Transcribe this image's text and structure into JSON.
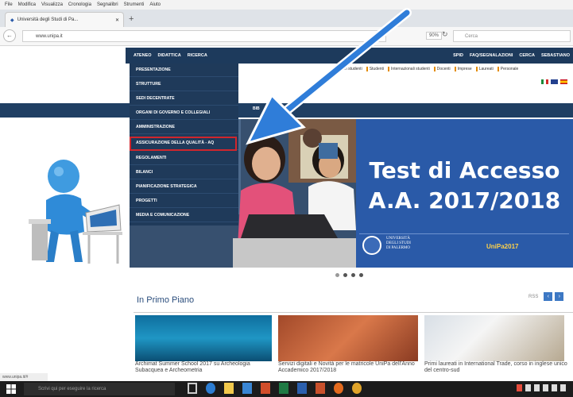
{
  "browser": {
    "menu": [
      "File",
      "Modifica",
      "Visualizza",
      "Cronologia",
      "Segnalibri",
      "Strumenti",
      "Aiuto"
    ],
    "tab_title": "Università degli Studi di Pa...",
    "url": "www.unipa.it",
    "zoom": "90%",
    "search_placeholder": "Cerca"
  },
  "site": {
    "nav_left": [
      "ATENEO",
      "DIDATTICA",
      "RICERCA"
    ],
    "nav_right": [
      "SPID",
      "FAQ/SEGNALAZIONI",
      "CERCA",
      "SEBASTIANO"
    ],
    "sub_links": [
      "Futuri studenti",
      "Studenti",
      "Internazionali studenti",
      "Docenti",
      "Imprese",
      "Laureati",
      "Personale"
    ],
    "bluebar_text": "BIB",
    "dropdown": [
      "PRESENTAZIONE",
      "STRUTTURE",
      "SEDI DECENTRATE",
      "ORGANI DI GOVERNO E COLLEGIALI",
      "AMMINISTRAZIONE",
      "ASSICURAZIONE DELLA QUALITÀ - AQ",
      "REGOLAMENTI",
      "BILANCI",
      "PIANIFICAZIONE STRATEGICA",
      "PROGETTI",
      "MEDIA E COMUNICAZIONE"
    ],
    "hero": {
      "line1": "Test di Accesso",
      "line2": "A.A. 2017/2018",
      "uni_line1": "UNIVERSITÀ",
      "uni_line2": "DEGLI STUDI",
      "uni_line3": "DI PALERMO",
      "logo": "UniPa2017"
    },
    "primo_piano": {
      "title": "In Primo Piano",
      "controls_text": "RSS",
      "cards": [
        "Archimat Summer School 2017 su Archeologia Subacquea e Archeometria",
        "Servizi digitali e Novità per le matricole UniPa dell'Anno Accademico 2017/2018",
        "Primi laureati in International Trade, corso in inglese unico del centro-sud"
      ]
    }
  },
  "statusbar": "www.unipa.it/#",
  "taskbar": {
    "search_text": "Scrivi qui per eseguire la ricerca"
  }
}
